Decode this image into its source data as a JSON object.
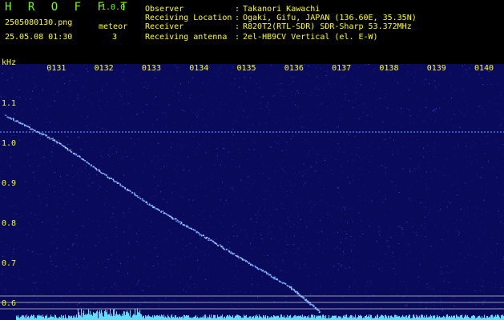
{
  "header": {
    "app_title": "H R O F F T",
    "app_version": "1.0.0",
    "file_name": "2505080130.png",
    "date_time": "25.05.08 01:30",
    "type_label": "meteor",
    "count_value": "3",
    "info": [
      {
        "label": "Observer",
        "value": "Takanori Kawachi"
      },
      {
        "label": "Receiving Location",
        "value": "Ogaki, Gifu, JAPAN (136.60E, 35.35N)"
      },
      {
        "label": "Receiver",
        "value": "R820T2(RTL-SDR) SDR-Sharp 53.372MHz"
      },
      {
        "label": "Receiving antenna",
        "value": "2el-HB9CV Vertical (el. E-W)"
      }
    ],
    "separator": ":"
  },
  "plot": {
    "unit": "kHz",
    "y_ticks": [
      "1.1",
      "1.0",
      "0.9",
      "0.8",
      "0.7",
      "0.6"
    ],
    "x_ticks": [
      "0131",
      "0132",
      "0133",
      "0134",
      "0135",
      "0136",
      "0137",
      "0138",
      "0139",
      "0140"
    ],
    "background_color": "#0a0a5a",
    "trace_color": "#6fa8ff",
    "carrier_color": "#4a6fd8",
    "baseline_color": "#5fdcff"
  },
  "chart_data": {
    "type": "scatter",
    "xlabel": "",
    "ylabel": "kHz",
    "x_ticks": [
      "0131",
      "0132",
      "0133",
      "0134",
      "0135",
      "0136",
      "0137",
      "0138",
      "0139",
      "0140"
    ],
    "ylim": [
      0.57,
      1.15
    ],
    "series": [
      {
        "x": [
          "0130",
          "0131",
          "0132",
          "0133",
          "0134",
          "0135",
          "0136",
          "0136.6"
        ],
        "values": [
          1.07,
          1.01,
          0.93,
          0.85,
          0.78,
          0.71,
          0.64,
          0.58
        ]
      },
      {
        "x": [
          "0130",
          "0140"
        ],
        "values": [
          1.03,
          1.03
        ]
      }
    ],
    "grid": false
  }
}
